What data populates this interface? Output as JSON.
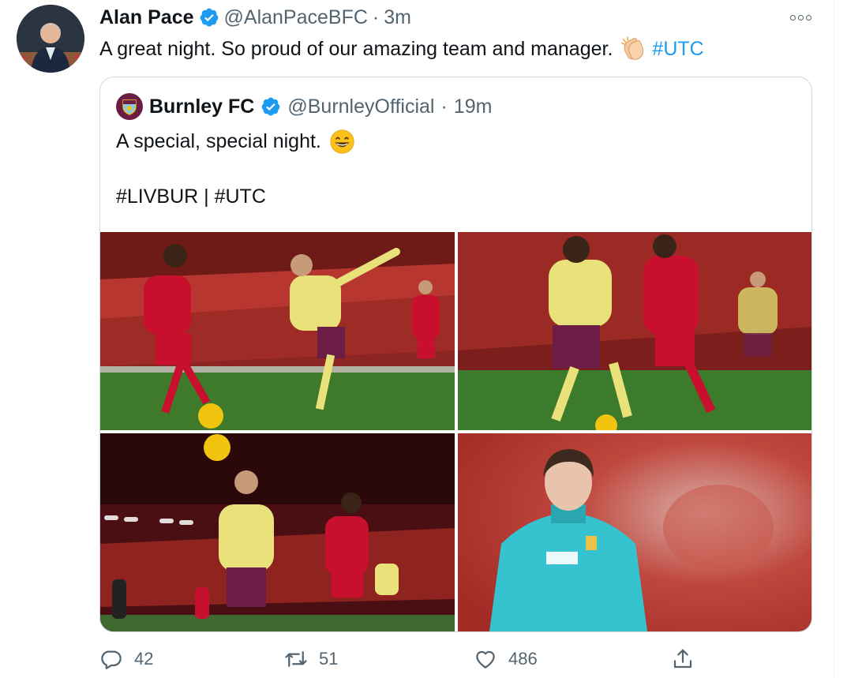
{
  "tweet": {
    "author": {
      "name": "Alan Pace",
      "handle": "@AlanPaceBFC",
      "verified": true
    },
    "separator": "·",
    "time": "3m",
    "text": "A great night. So proud of our amazing team and manager.",
    "emoji": "clapping-hands",
    "hashtag": "#UTC",
    "more_icon": "more-horizontal-icon"
  },
  "quoted_tweet": {
    "author": {
      "name": "Burnley FC",
      "handle": "@BurnleyOfficial",
      "verified": true
    },
    "separator": "·",
    "time": "19m",
    "line1": "A special, special night.",
    "emoji": "grinning-face",
    "line2": "#LIVBUR | #UTC"
  },
  "actions": {
    "reply": {
      "icon": "reply-icon",
      "count": "42"
    },
    "retweet": {
      "icon": "retweet-icon",
      "count": "51"
    },
    "like": {
      "icon": "heart-icon",
      "count": "486"
    },
    "share": {
      "icon": "share-icon"
    }
  },
  "colors": {
    "link": "#1d9bf0",
    "muted": "#536471",
    "liverpool_red": "#c8102e",
    "burnley_claret": "#6c1d45",
    "burnley_kit_yellow": "#e9e27a",
    "pitch_green": "#3f7a2a",
    "gk_kit_cyan": "#35c4cf"
  }
}
